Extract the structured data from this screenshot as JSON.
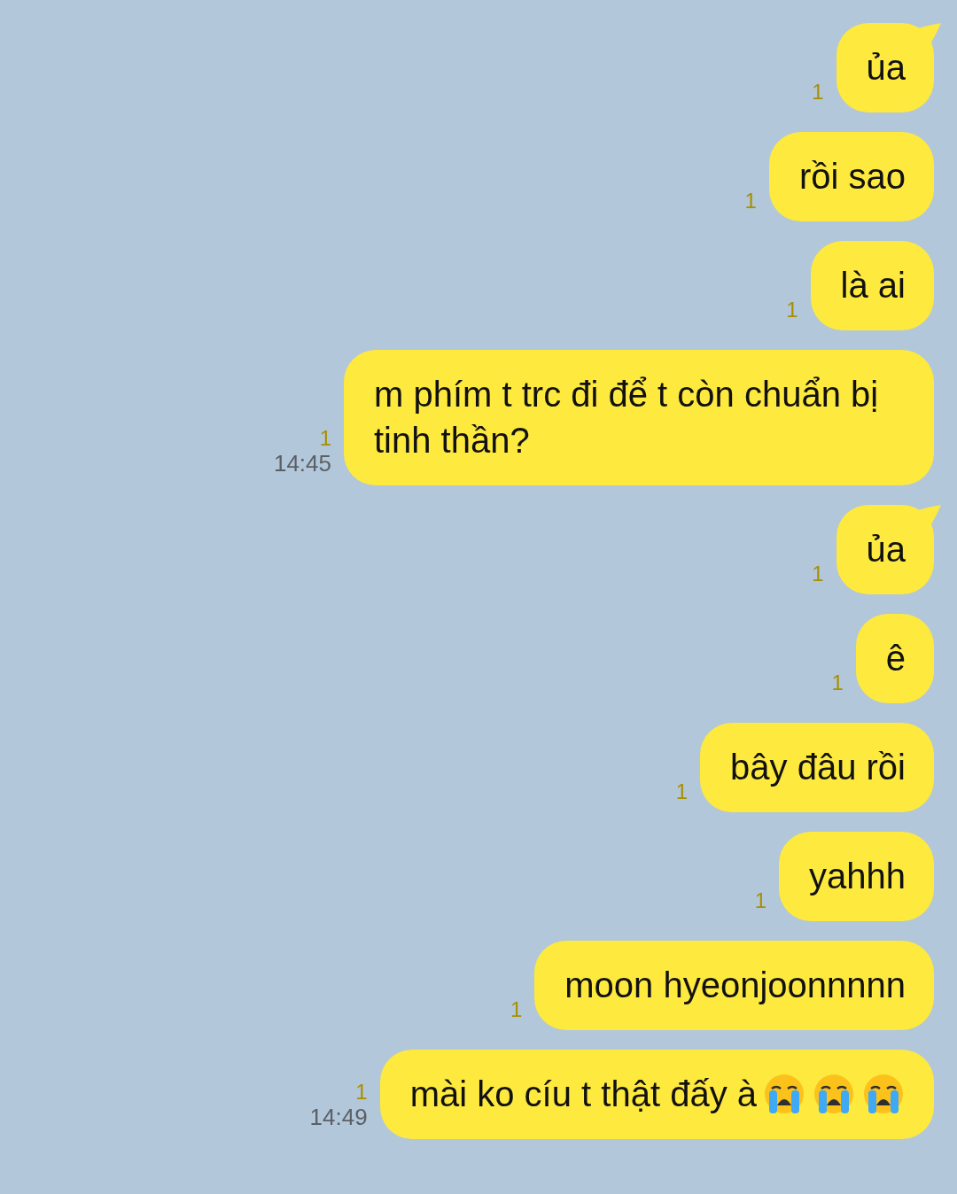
{
  "messages": [
    {
      "text": "ủa",
      "unread": "1",
      "tail": true
    },
    {
      "text": "rồi sao",
      "unread": "1",
      "tail": false
    },
    {
      "text": "là ai",
      "unread": "1",
      "tail": false
    },
    {
      "text": "m phím t trc đi để t còn chuẩn bị tinh thần?",
      "unread": "1",
      "time": "14:45",
      "tail": false
    },
    {
      "text": "ủa",
      "unread": "1",
      "tail": true
    },
    {
      "text": "ê",
      "unread": "1",
      "tail": false
    },
    {
      "text": "bây đâu rồi",
      "unread": "1",
      "tail": false
    },
    {
      "text": "yahhh",
      "unread": "1",
      "tail": false
    },
    {
      "text": "moon hyeonjoonnnnn",
      "unread": "1",
      "tail": false
    },
    {
      "text": "mài ko cíu t thật đấy à",
      "unread": "1",
      "time": "14:49",
      "tail": false,
      "icons": [
        {
          "kind": "crying"
        },
        {
          "kind": "crying"
        },
        {
          "kind": "crying"
        }
      ]
    }
  ]
}
